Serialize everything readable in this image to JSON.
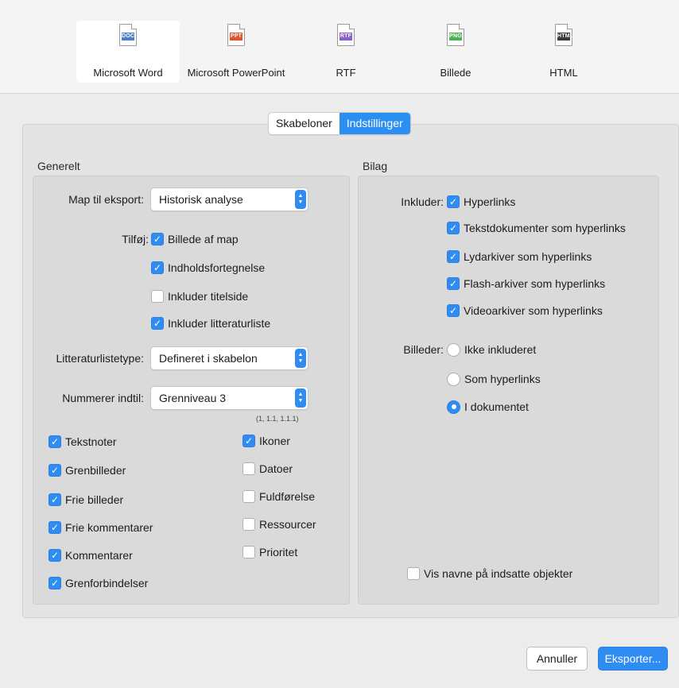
{
  "formats": [
    {
      "tag": "DOC",
      "label": "Microsoft Word",
      "color": "#4a7fd0",
      "selected": true
    },
    {
      "tag": "PPT",
      "label": "Microsoft PowerPoint",
      "color": "#e2522f",
      "selected": false
    },
    {
      "tag": "RTF",
      "label": "RTF",
      "color": "#8a5fc7",
      "selected": false
    },
    {
      "tag": "PNG",
      "label": "Billede",
      "color": "#4caf50",
      "selected": false
    },
    {
      "tag": "HTML",
      "label": "HTML",
      "color": "#3a3a3a",
      "selected": false
    }
  ],
  "tabs": {
    "templates": "Skabeloner",
    "settings": "Indstillinger",
    "active": "settings"
  },
  "general": {
    "title": "Generelt",
    "map_label": "Map til eksport:",
    "map_value": "Historisk analyse",
    "add_label": "Tilføj:",
    "add_options": [
      {
        "label": "Billede af map",
        "checked": true
      },
      {
        "label": "Indholdsfortegnelse",
        "checked": true
      },
      {
        "label": "Inkluder titelside",
        "checked": false
      },
      {
        "label": "Inkluder litteraturliste",
        "checked": true
      }
    ],
    "bib_label": "Litteraturlistetype:",
    "bib_value": "Defineret i skabelon",
    "number_label": "Nummerer indtil:",
    "number_value": "Grenniveau 3",
    "number_hint": "(1, 1.1, 1.1.1)",
    "left_checks": [
      {
        "label": "Tekstnoter",
        "checked": true
      },
      {
        "label": "Grenbilleder",
        "checked": true
      },
      {
        "label": "Frie billeder",
        "checked": true
      },
      {
        "label": "Frie kommentarer",
        "checked": true
      },
      {
        "label": "Kommentarer",
        "checked": true
      },
      {
        "label": "Grenforbindelser",
        "checked": true
      }
    ],
    "right_checks": [
      {
        "label": "Ikoner",
        "checked": true
      },
      {
        "label": "Datoer",
        "checked": false
      },
      {
        "label": "Fuldførelse",
        "checked": false
      },
      {
        "label": "Ressourcer",
        "checked": false
      },
      {
        "label": "Prioritet",
        "checked": false
      }
    ]
  },
  "attachments": {
    "title": "Bilag",
    "include_label": "Inkluder:",
    "include_options": [
      {
        "label": "Hyperlinks",
        "checked": true
      },
      {
        "label": "Tekstdokumenter som hyperlinks",
        "checked": true
      },
      {
        "label": "Lydarkiver som hyperlinks",
        "checked": true
      },
      {
        "label": "Flash-arkiver som hyperlinks",
        "checked": true
      },
      {
        "label": "Videoarkiver som hyperlinks",
        "checked": true
      }
    ],
    "images_label": "Billeder:",
    "images_options": [
      {
        "label": "Ikke inkluderet",
        "selected": false
      },
      {
        "label": "Som hyperlinks",
        "selected": false
      },
      {
        "label": "I dokumentet",
        "selected": true
      }
    ],
    "show_names_label": "Vis navne på indsatte objekter",
    "show_names_checked": false
  },
  "buttons": {
    "cancel": "Annuller",
    "export": "Eksporter..."
  },
  "colors": {
    "accent": "#2f8cf2"
  }
}
